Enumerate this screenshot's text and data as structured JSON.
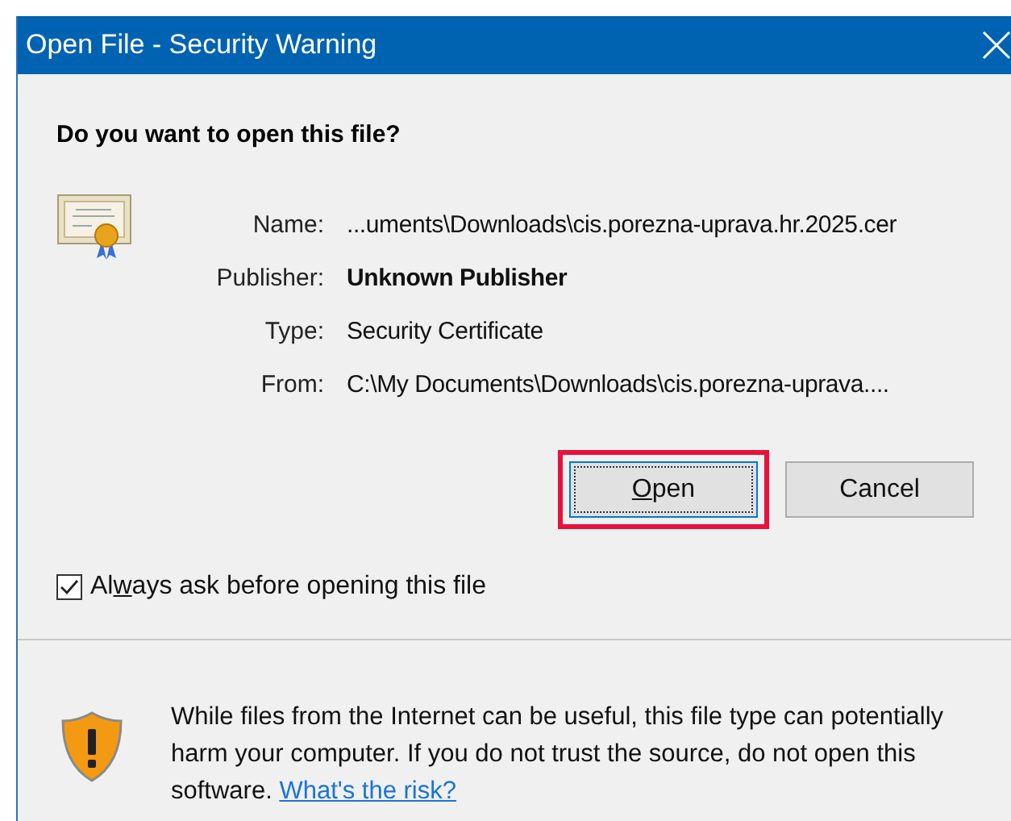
{
  "window": {
    "title": "Open File - Security Warning"
  },
  "question": "Do you want to open this file?",
  "fields": [
    {
      "label": "Name:",
      "value": "...uments\\Downloads\\cis.porezna-uprava.hr.2025.cer",
      "bold": false
    },
    {
      "label": "Publisher:",
      "value": "Unknown Publisher",
      "bold": true
    },
    {
      "label": "Type:",
      "value": "Security Certificate",
      "bold": false
    },
    {
      "label": "From:",
      "value": "C:\\My Documents\\Downloads\\cis.porezna-uprava....",
      "bold": false
    }
  ],
  "buttons": [
    {
      "label": [
        {
          "text": "O",
          "underline": true
        },
        {
          "text": "pen",
          "underline": false
        }
      ],
      "focused": true,
      "highlighted": true
    },
    {
      "label": [
        {
          "text": "Cancel",
          "underline": false
        }
      ],
      "focused": false,
      "highlighted": false
    }
  ],
  "always_ask": {
    "checked": true,
    "label": [
      {
        "text": "Al",
        "underline": false
      },
      {
        "text": "w",
        "underline": true
      },
      {
        "text": "ays ask before opening this file",
        "underline": false
      }
    ]
  },
  "warning": {
    "text": "While files from the Internet can be useful, this file type can potentially harm your computer. If you do not trust the source, do not open this software.",
    "link": "What's the risk?"
  }
}
